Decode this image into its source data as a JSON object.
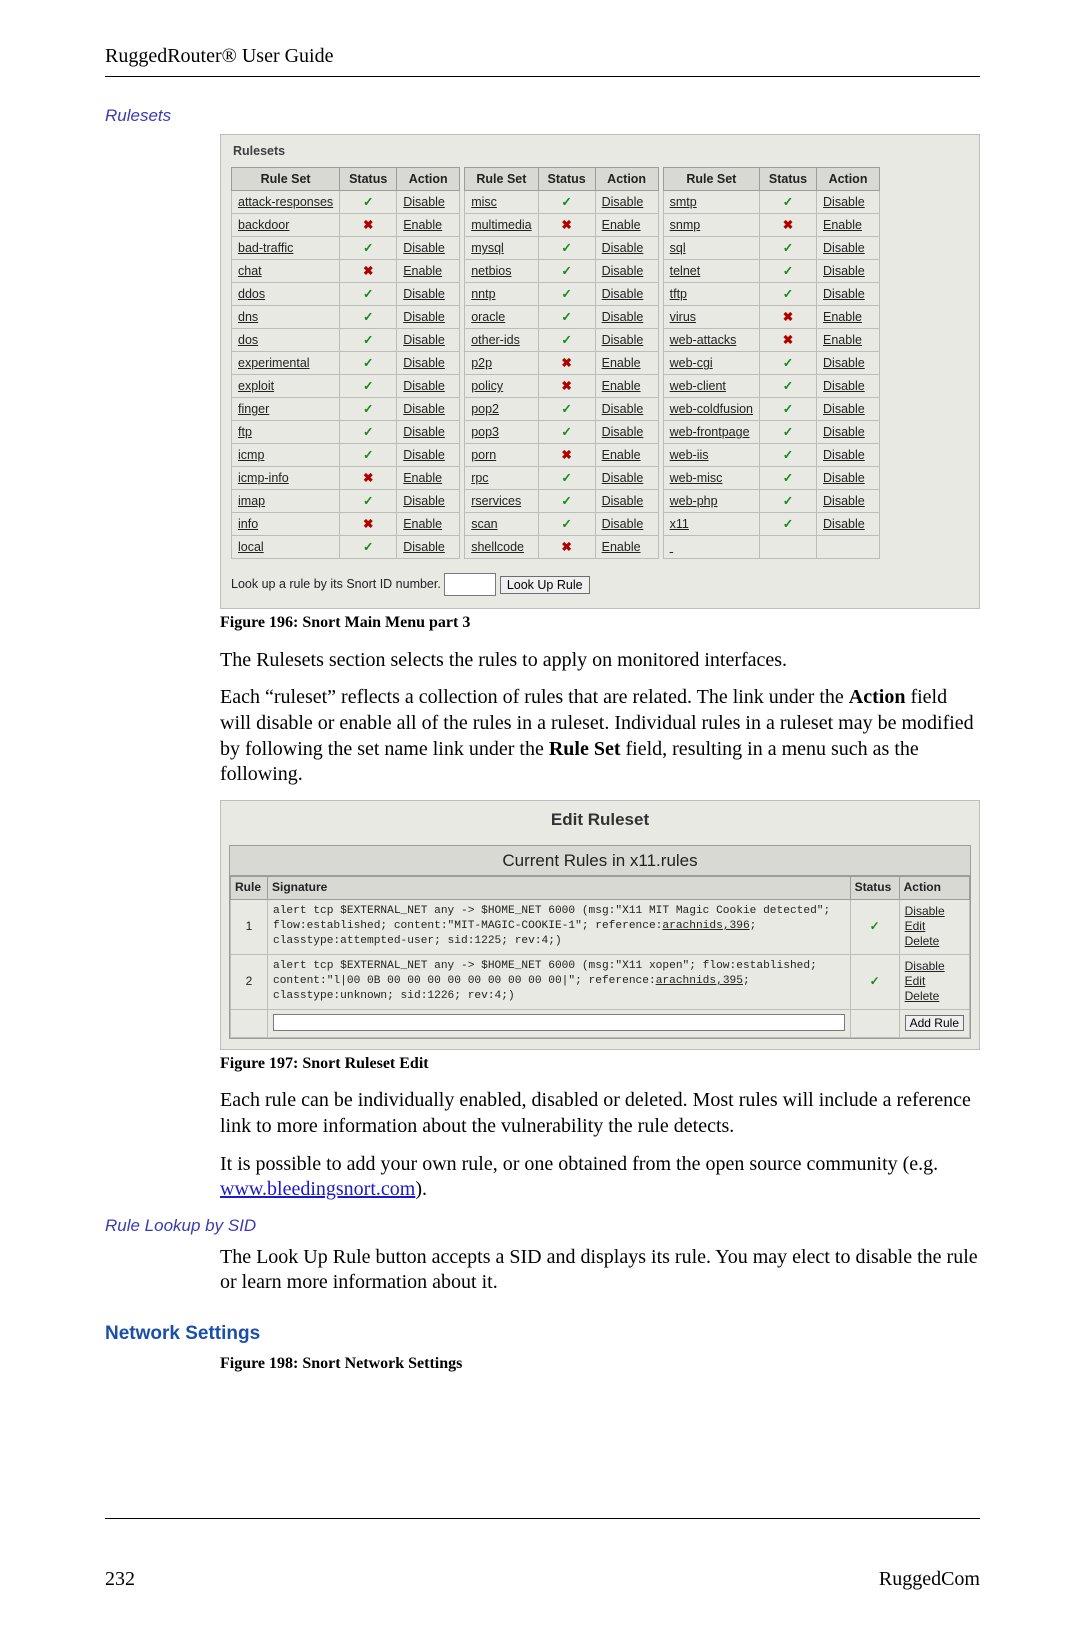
{
  "header": {
    "title": "RuggedRouter® User Guide"
  },
  "h_rulesets": "Rulesets",
  "rulesets_panel_title": "Rulesets",
  "cols": {
    "ruleset": "Rule Set",
    "status": "Status",
    "action": "Action"
  },
  "col1": [
    {
      "name": "attack-responses",
      "on": true,
      "action": "Disable"
    },
    {
      "name": "backdoor",
      "on": false,
      "action": "Enable"
    },
    {
      "name": "bad-traffic",
      "on": true,
      "action": "Disable"
    },
    {
      "name": "chat",
      "on": false,
      "action": "Enable"
    },
    {
      "name": "ddos",
      "on": true,
      "action": "Disable"
    },
    {
      "name": "dns",
      "on": true,
      "action": "Disable"
    },
    {
      "name": "dos",
      "on": true,
      "action": "Disable"
    },
    {
      "name": "experimental",
      "on": true,
      "action": "Disable"
    },
    {
      "name": "exploit",
      "on": true,
      "action": "Disable"
    },
    {
      "name": "finger",
      "on": true,
      "action": "Disable"
    },
    {
      "name": "ftp",
      "on": true,
      "action": "Disable"
    },
    {
      "name": "icmp",
      "on": true,
      "action": "Disable"
    },
    {
      "name": "icmp-info",
      "on": false,
      "action": "Enable"
    },
    {
      "name": "imap",
      "on": true,
      "action": "Disable"
    },
    {
      "name": "info",
      "on": false,
      "action": "Enable"
    },
    {
      "name": "local",
      "on": true,
      "action": "Disable"
    }
  ],
  "col2": [
    {
      "name": "misc",
      "on": true,
      "action": "Disable"
    },
    {
      "name": "multimedia",
      "on": false,
      "action": "Enable"
    },
    {
      "name": "mysql",
      "on": true,
      "action": "Disable"
    },
    {
      "name": "netbios",
      "on": true,
      "action": "Disable"
    },
    {
      "name": "nntp",
      "on": true,
      "action": "Disable"
    },
    {
      "name": "oracle",
      "on": true,
      "action": "Disable"
    },
    {
      "name": "other-ids",
      "on": true,
      "action": "Disable"
    },
    {
      "name": "p2p",
      "on": false,
      "action": "Enable"
    },
    {
      "name": "policy",
      "on": false,
      "action": "Enable"
    },
    {
      "name": "pop2",
      "on": true,
      "action": "Disable"
    },
    {
      "name": "pop3",
      "on": true,
      "action": "Disable"
    },
    {
      "name": "porn",
      "on": false,
      "action": "Enable"
    },
    {
      "name": "rpc",
      "on": true,
      "action": "Disable"
    },
    {
      "name": "rservices",
      "on": true,
      "action": "Disable"
    },
    {
      "name": "scan",
      "on": true,
      "action": "Disable"
    },
    {
      "name": "shellcode",
      "on": false,
      "action": "Enable"
    }
  ],
  "col3": [
    {
      "name": "smtp",
      "on": true,
      "action": "Disable"
    },
    {
      "name": "snmp",
      "on": false,
      "action": "Enable"
    },
    {
      "name": "sql",
      "on": true,
      "action": "Disable"
    },
    {
      "name": "telnet",
      "on": true,
      "action": "Disable"
    },
    {
      "name": "tftp",
      "on": true,
      "action": "Disable"
    },
    {
      "name": "virus",
      "on": false,
      "action": "Enable"
    },
    {
      "name": "web-attacks",
      "on": false,
      "action": "Enable"
    },
    {
      "name": "web-cgi",
      "on": true,
      "action": "Disable"
    },
    {
      "name": "web-client",
      "on": true,
      "action": "Disable"
    },
    {
      "name": "web-coldfusion",
      "on": true,
      "action": "Disable"
    },
    {
      "name": "web-frontpage",
      "on": true,
      "action": "Disable"
    },
    {
      "name": "web-iis",
      "on": true,
      "action": "Disable"
    },
    {
      "name": "web-misc",
      "on": true,
      "action": "Disable"
    },
    {
      "name": "web-php",
      "on": true,
      "action": "Disable"
    },
    {
      "name": "x11",
      "on": true,
      "action": "Disable"
    },
    {
      "name": "",
      "on": null,
      "action": ""
    }
  ],
  "lookup": {
    "label": "Look up a rule by its Snort ID number.",
    "button": "Look Up Rule"
  },
  "fig196": "Figure 196:  Snort Main Menu part 3",
  "p1": "The Rulesets section selects the rules to apply on monitored interfaces.",
  "p2a": "Each “ruleset” reflects a collection of rules that are related.  The link under the ",
  "p2b": "Action",
  "p2c": " field will disable or enable all of the rules in a ruleset.  Individual rules in a ruleset may be modified by following the set name link under the ",
  "p2d": "Rule Set",
  "p2e": " field, resulting in a menu such as the following.",
  "edit_title": "Edit Ruleset",
  "current_caption": "Current Rules in x11.rules",
  "edit_cols": {
    "rule": "Rule",
    "sig": "Signature",
    "status": "Status",
    "action": "Action"
  },
  "edit_rows": [
    {
      "n": "1",
      "siga": "alert tcp $EXTERNAL_NET any -> $HOME_NET 6000 (msg:\"X11 MIT Magic Cookie detected\"; flow:established; content:\"MIT-MAGIC-COOKIE-1\"; reference:",
      "ref": "arachnids,396",
      "sigb": "; classtype:attempted-user; sid:1225; rev:4;)",
      "on": true,
      "actions": [
        "Disable",
        "Edit",
        "Delete"
      ]
    },
    {
      "n": "2",
      "siga": "alert tcp $EXTERNAL_NET any -> $HOME_NET 6000 (msg:\"X11 xopen\"; flow:established; content:\"l|00 0B 00 00 00 00 00 00 00 00 00|\"; reference:",
      "ref": "arachnids,395",
      "sigb": "; classtype:unknown; sid:1226; rev:4;)",
      "on": true,
      "actions": [
        "Disable",
        "Edit",
        "Delete"
      ]
    }
  ],
  "add_rule_btn": "Add Rule",
  "fig197": "Figure 197:  Snort Ruleset Edit",
  "p3": "Each rule can be individually enabled, disabled or deleted.  Most rules will include a reference link to more information about the vulnerability the rule detects.",
  "p4a": "It is possible to add your own rule, or one obtained from the open source community (e.g. ",
  "p4link": "www.bleedingsnort.com",
  "p4b": ").",
  "h_lookup": "Rule Lookup by SID",
  "p5": "The Look Up Rule button accepts a SID and displays its rule.  You may elect to disable the rule or learn more information about it.",
  "h_net": "Network Settings",
  "fig198": "Figure 198:  Snort Network Settings",
  "footer": {
    "page": "232",
    "brand": "RuggedCom"
  },
  "glyph": {
    "tick": "✓",
    "cross": "✖"
  }
}
